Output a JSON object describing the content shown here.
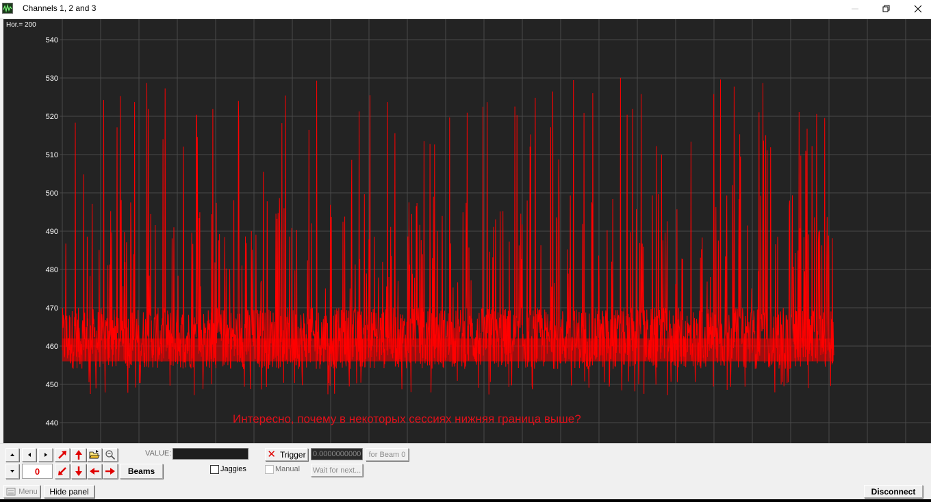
{
  "window": {
    "title": "Channels 1, 2 and 3",
    "icon": "oscilloscope-app-icon"
  },
  "plot": {
    "hor_label": "Hor.= 200",
    "y_ticks": [
      "540",
      "530",
      "520",
      "510",
      "500",
      "490",
      "480",
      "470",
      "460",
      "450",
      "440"
    ],
    "annotation": "Интересно, почему в некоторых сессиях нижняя граница выше?",
    "background": "#232323",
    "grid_color": "#4a4a4a",
    "trace_color": "#ff0000",
    "annotation_color": "#e0101a"
  },
  "chart_data": {
    "type": "line",
    "title": "",
    "xlabel": "",
    "ylabel": "",
    "ylim": [
      438,
      542
    ],
    "grid": true,
    "y_ticks": [
      540,
      530,
      520,
      510,
      500,
      490,
      480,
      470,
      460,
      450,
      440
    ],
    "series": [
      {
        "color": "#ff0000",
        "baseline_range": [
          454,
          470
        ],
        "min_value": 445,
        "max_value": 532,
        "sample_peaks": [
          515,
          504,
          517,
          523,
          530,
          521,
          531,
          516,
          508,
          513,
          517,
          527,
          531,
          520,
          509,
          516,
          515,
          511,
          521,
          529,
          532,
          521,
          526,
          517,
          526,
          531,
          527,
          530,
          522,
          529,
          524,
          526,
          528,
          502
        ]
      }
    ]
  },
  "controls": {
    "counter_value": "0",
    "beams_label": "Beams",
    "value_label": "VALUE:",
    "jaggies_label": "Jaggies",
    "trigger_label": "Trigger",
    "trigger_value": "0.0000000000",
    "for_beam_label": "for Beam 0",
    "manual_label": "Manual",
    "wait_label": "Wait for next...",
    "icons": {
      "scroll_up": "scroll-up-icon",
      "scroll_down": "scroll-down-icon",
      "left": "step-left-icon",
      "right": "step-right-icon",
      "arrow_ne": "arrow-up-right-icon",
      "arrow_up": "arrow-up-icon",
      "open": "open-folder-icon",
      "zoom": "zoom-icon",
      "arrow_sw": "arrow-down-left-icon",
      "arrow_down": "arrow-down-icon",
      "arrow_left": "arrow-left-icon",
      "arrow_right": "arrow-right-icon"
    }
  },
  "bottombar": {
    "menu_label": "Menu",
    "hide_panel_label": "Hide panel",
    "disconnect_label": "Disconnect"
  }
}
